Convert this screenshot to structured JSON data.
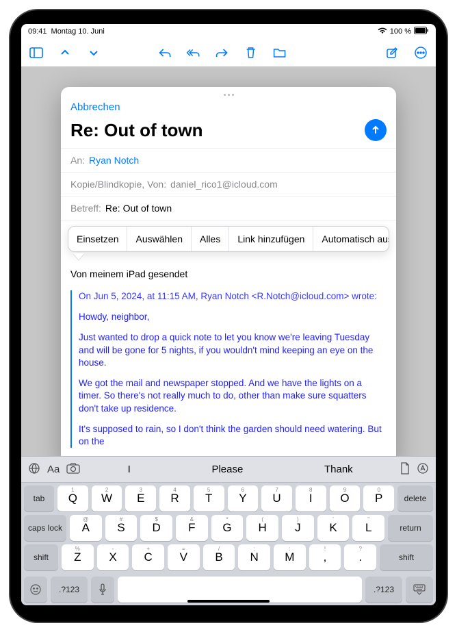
{
  "status": {
    "time": "09:41",
    "date": "Montag 10. Juni",
    "battery": "100 %"
  },
  "compose": {
    "cancel": "Abbrechen",
    "title": "Re: Out of town",
    "to_label": "An:",
    "to_value": "Ryan Notch",
    "ccbcc_label": "Kopie/Blindkopie, Von:",
    "ccbcc_value": "daniel_rico1@icloud.com",
    "subject_label": "Betreff:",
    "subject_value": "Re: Out of town",
    "signature": "Von meinem iPad gesendet",
    "quote_meta": "On Jun 5, 2024, at 11:15 AM, Ryan Notch <R.Notch@icloud.com> wrote:",
    "quote_p1": "Howdy, neighbor,",
    "quote_p2": "Just wanted to drop a quick note to let you know we're leaving Tuesday and will be gone for 5 nights, if you wouldn't mind keeping an eye on the house.",
    "quote_p3": "We got the mail and newspaper stopped. And we have the lights on a timer. So there's not really much to do, other than make sure squatters don't take up residence.",
    "quote_p4": "It's supposed to rain, so I don't think the garden should need watering. But on the"
  },
  "context_menu": {
    "paste": "Einsetzen",
    "select": "Auswählen",
    "all": "Alles",
    "addlink": "Link hinzufügen",
    "autofill": "Automatisch ausfüllen"
  },
  "keyboard": {
    "suggestions": {
      "s1": "I",
      "s2": "Please",
      "s3": "Thank"
    },
    "row1": [
      "Q",
      "W",
      "E",
      "R",
      "T",
      "Y",
      "U",
      "I",
      "O",
      "P"
    ],
    "hint1": [
      "1",
      "2",
      "3",
      "4",
      "5",
      "6",
      "7",
      "8",
      "9",
      "0"
    ],
    "row2": [
      "A",
      "S",
      "D",
      "F",
      "G",
      "H",
      "J",
      "K",
      "L"
    ],
    "hint2": [
      "@",
      "#",
      "$",
      "&",
      "*",
      "(",
      ")",
      "'",
      "\""
    ],
    "row3": [
      "Z",
      "X",
      "C",
      "V",
      "B",
      "N",
      "M",
      ",",
      "."
    ],
    "hint3": [
      "%",
      "-",
      "+",
      "=",
      "/",
      ";",
      ":",
      "!",
      "?"
    ],
    "tab": "tab",
    "delete": "delete",
    "caps": "caps lock",
    "return": "return",
    "shift": "shift",
    "numkey": ".?123"
  }
}
